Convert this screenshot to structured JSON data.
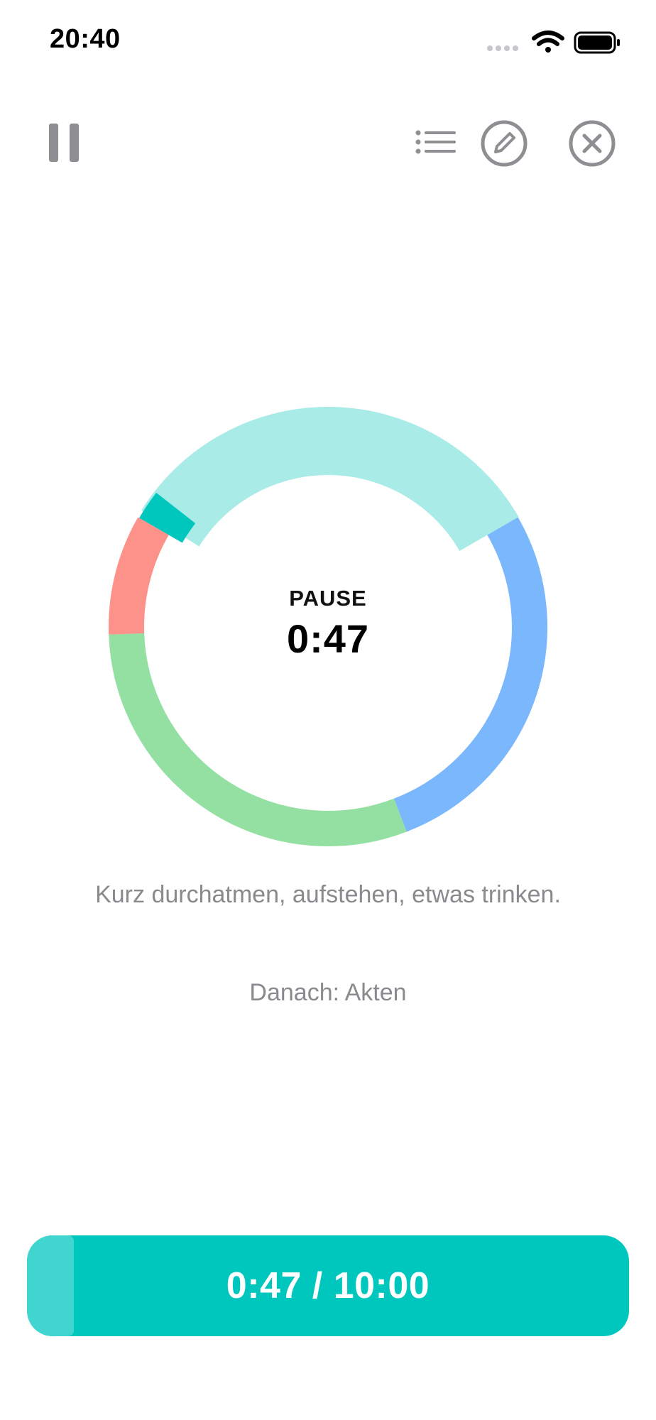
{
  "status_bar": {
    "time": "20:40",
    "icons": [
      "cellular-signal-icon",
      "wifi-icon",
      "battery-icon"
    ]
  },
  "toolbar": {
    "icons": [
      "pause-icon",
      "list-icon",
      "edit-pencil-icon",
      "close-circle-icon"
    ]
  },
  "timer": {
    "phase_label": "PAUSE",
    "phase_remaining": "0:47",
    "segments": [
      {
        "color": "#a8ebe7",
        "role": "active-break"
      },
      {
        "color": "#7ab7fc",
        "role": "segment"
      },
      {
        "color": "#93e0a2",
        "role": "segment"
      },
      {
        "color": "#fd928b",
        "role": "segment"
      },
      {
        "color": "#00c7be",
        "role": "marker"
      }
    ]
  },
  "message": "Kurz durchatmen, aufstehen, etwas trinken.",
  "next_label": "Danach: Akten",
  "progress": {
    "text": "0:47 / 10:00",
    "elapsed_fraction": 0.078,
    "track_color": "#00c7be",
    "fill_color": "#40d6cf"
  }
}
